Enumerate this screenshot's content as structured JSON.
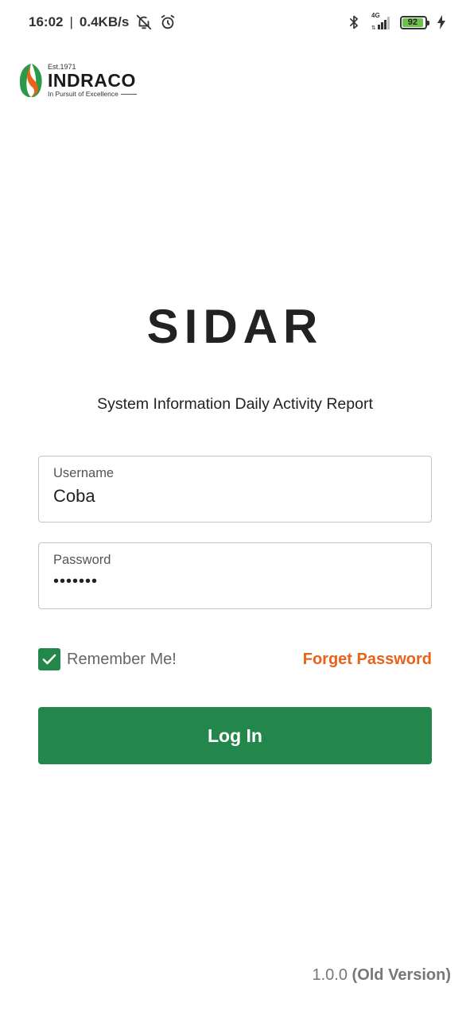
{
  "status_bar": {
    "time": "16:02",
    "separator": "|",
    "net_speed": "0.4KB/s",
    "network_type": "4G",
    "battery_level": "92",
    "icons": [
      "notifications-off-icon",
      "alarm-icon",
      "bluetooth-icon",
      "signal-icon",
      "battery-icon",
      "charging-icon"
    ]
  },
  "logo": {
    "est": "Est.1971",
    "name": "INDRACO",
    "tagline": "In Pursuit of Excellence",
    "colors": {
      "orange": "#e8621a",
      "green": "#2a9a4a"
    }
  },
  "app": {
    "title": "SIDAR",
    "subtitle": "System Information Daily Activity Report"
  },
  "form": {
    "username": {
      "label": "Username",
      "value": "Coba"
    },
    "password": {
      "label": "Password",
      "value": "•••••••"
    },
    "remember_label": "Remember Me!",
    "remember_checked": true,
    "forget_label": "Forget Password",
    "login_label": "Log In"
  },
  "footer": {
    "version": "1.0.0",
    "version_note": "(Old Version)"
  },
  "colors": {
    "primary_green": "#23874c",
    "accent_orange": "#e8621a",
    "text_dark": "#222222",
    "text_muted": "#777777",
    "border": "#c4c4c4"
  }
}
